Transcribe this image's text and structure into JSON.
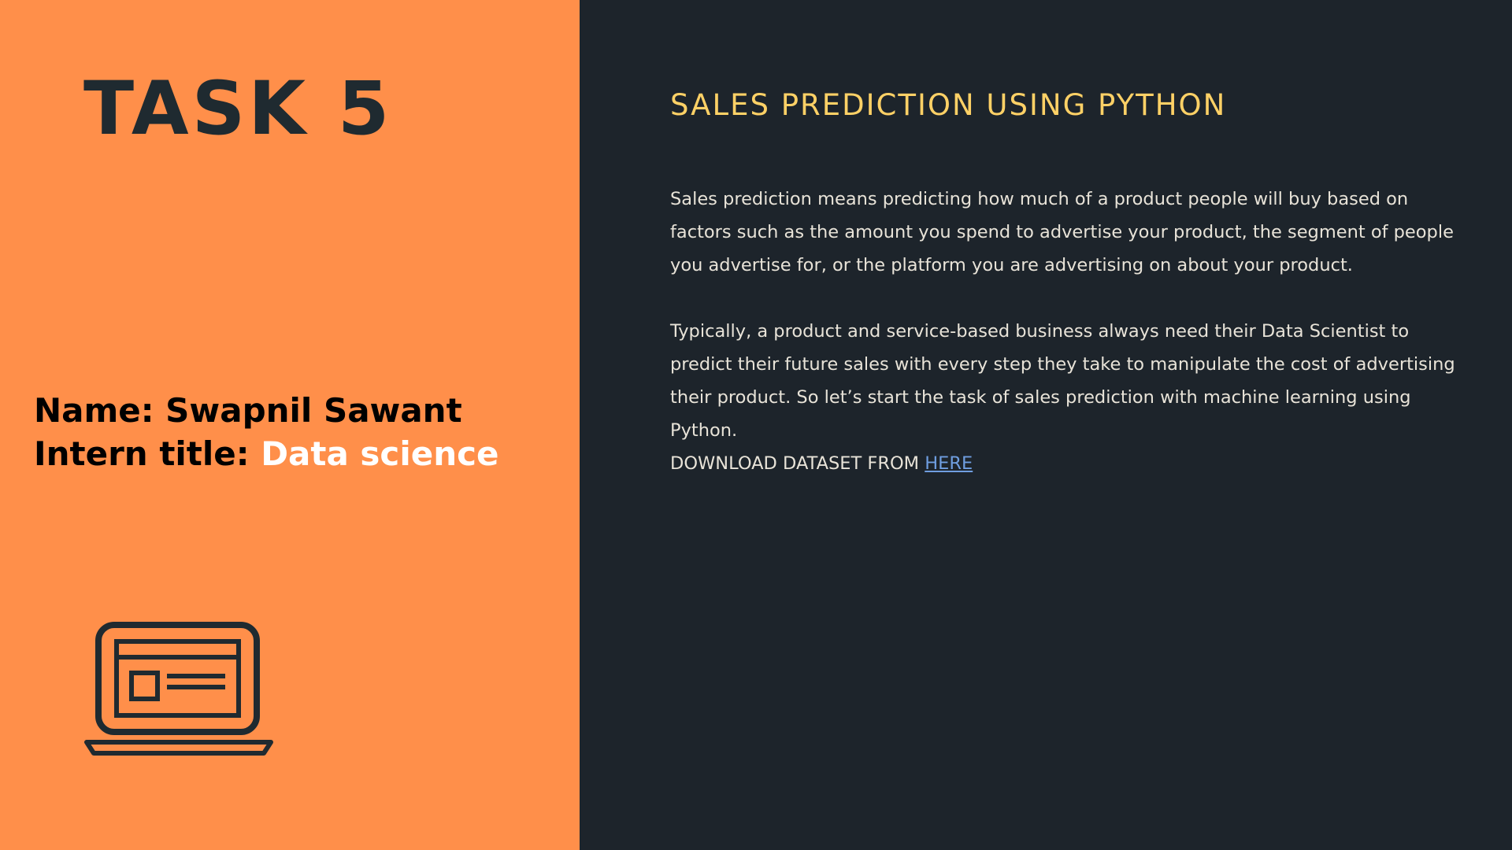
{
  "left": {
    "task_title": "TASK 5",
    "name_label": "Name: ",
    "name_value": "Swapnil Sawant",
    "intern_label": "Intern title: ",
    "intern_value": "Data science",
    "icon": "laptop-icon"
  },
  "right": {
    "heading": "SALES PREDICTION USING PYTHON",
    "paragraph_1": "Sales prediction means predicting how much of a product people will buy based on factors such as the amount you spend to advertise your product, the segment of people you advertise for, or the platform you are advertising on about your product.",
    "paragraph_2": "Typically, a product and service-based business always need their Data Scientist to predict their future sales with every step they take to manipulate the cost of advertising their product. So let’s start the task of sales prediction with machine learning using Python.",
    "download_prefix": "DOWNLOAD DATASET FROM ",
    "download_link": "HERE"
  },
  "colors": {
    "left_background": "#ff8f4a",
    "right_background": "#1d242b",
    "heading": "#ffd166",
    "body_text": "#e8e3d8",
    "link": "#6f9ee0",
    "dark_text": "#1f2a30"
  }
}
